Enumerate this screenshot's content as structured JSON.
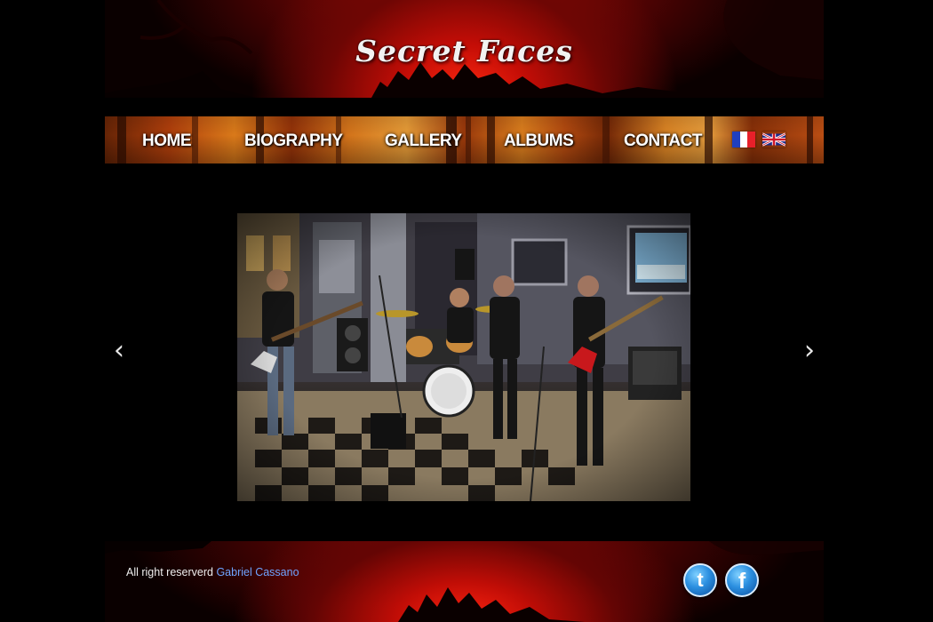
{
  "site": {
    "logo_text": "Secret Faces"
  },
  "nav": {
    "items": [
      {
        "label": "HOME"
      },
      {
        "label": "BIOGRAPHY"
      },
      {
        "label": "GALLERY"
      },
      {
        "label": "ALBUMS"
      },
      {
        "label": "CONTACT"
      }
    ],
    "languages": [
      "french-flag-icon",
      "uk-flag-icon"
    ]
  },
  "carousel": {
    "prev_label": "‹",
    "next_label": "›",
    "slide_description": "band-photo"
  },
  "footer": {
    "copyright_prefix": "All right reserverd",
    "author_link": "Gabriel Cassano",
    "social": [
      {
        "icon": "twitter-icon",
        "glyph": "t"
      },
      {
        "icon": "facebook-icon",
        "glyph": "f"
      }
    ]
  },
  "colors": {
    "background": "#000000",
    "header_red": "#c40d06",
    "nav_orange": "#e5801b",
    "link_blue": "#6fa4ff"
  }
}
